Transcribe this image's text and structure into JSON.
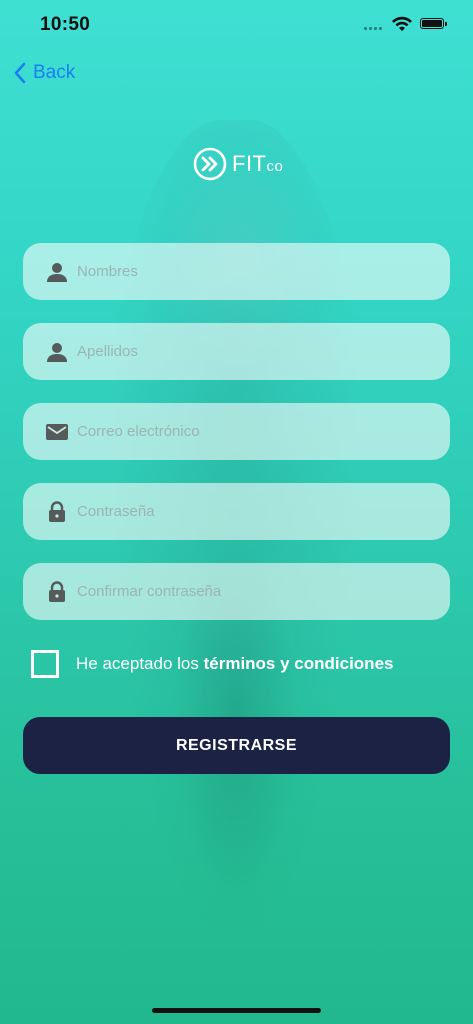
{
  "status_bar": {
    "time": "10:50"
  },
  "nav": {
    "back_label": "Back"
  },
  "logo": {
    "main": "FIT",
    "suffix": "co"
  },
  "form": {
    "fields": [
      {
        "placeholder": "Nombres",
        "value": "",
        "icon": "person-icon"
      },
      {
        "placeholder": "Apellidos",
        "value": "",
        "icon": "person-icon"
      },
      {
        "placeholder": "Correo electrónico",
        "value": "",
        "icon": "envelope-icon"
      },
      {
        "placeholder": "Contraseña",
        "value": "",
        "icon": "lock-icon"
      },
      {
        "placeholder": "Confirmar contraseña",
        "value": "",
        "icon": "lock-icon"
      }
    ],
    "terms_prefix": "He aceptado los ",
    "terms_link": "términos y condiciones",
    "terms_checked": false,
    "submit_label": "REGISTRARSE"
  },
  "colors": {
    "accent": "#34d6c7",
    "button": "#1b2244",
    "back_link": "#1a7ff0",
    "icon": "#555a5a"
  }
}
